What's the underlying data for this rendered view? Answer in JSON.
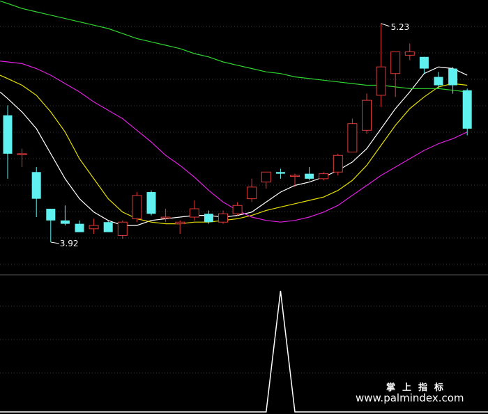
{
  "colors": {
    "background": "#000000",
    "grid": "#3a3a3a",
    "divider": "#555555",
    "candle_up": "#e03a3a",
    "candle_down": "#5ff0f0",
    "ma_short": "#ffffff",
    "ma_mid": "#e8e000",
    "ma_long": "#e020e0",
    "ma_longest": "#2fd42f",
    "indicator": "#ffffff"
  },
  "annotations": {
    "high_label": "5.23",
    "low_label": "3.92"
  },
  "watermark": {
    "cn": "掌上指标",
    "url": "www.palmindex.com"
  },
  "chart_data": [
    {
      "type": "candlestick",
      "title": "",
      "ylim": [
        3.82,
        5.35
      ],
      "grid": true,
      "candles": [
        {
          "o": 4.68,
          "h": 4.74,
          "l": 4.3,
          "c": 4.45
        },
        {
          "o": 4.45,
          "h": 4.48,
          "l": 4.37,
          "c": 4.45
        },
        {
          "o": 4.34,
          "h": 4.37,
          "l": 4.07,
          "c": 4.18
        },
        {
          "o": 4.12,
          "h": 4.12,
          "l": 3.92,
          "c": 4.05
        },
        {
          "o": 4.05,
          "h": 4.14,
          "l": 4.02,
          "c": 4.03
        },
        {
          "o": 4.03,
          "h": 4.05,
          "l": 3.98,
          "c": 3.98
        },
        {
          "o": 4.0,
          "h": 4.06,
          "l": 3.97,
          "c": 4.02
        },
        {
          "o": 4.04,
          "h": 4.05,
          "l": 3.98,
          "c": 3.98
        },
        {
          "o": 3.96,
          "h": 4.05,
          "l": 3.94,
          "c": 4.04
        },
        {
          "o": 4.06,
          "h": 4.22,
          "l": 4.04,
          "c": 4.2
        },
        {
          "o": 4.22,
          "h": 4.23,
          "l": 4.08,
          "c": 4.09
        },
        {
          "o": 4.07,
          "h": 4.12,
          "l": 4.04,
          "c": 4.07
        },
        {
          "o": 4.03,
          "h": 4.05,
          "l": 3.97,
          "c": 4.04
        },
        {
          "o": 4.07,
          "h": 4.17,
          "l": 4.05,
          "c": 4.12
        },
        {
          "o": 4.09,
          "h": 4.11,
          "l": 4.03,
          "c": 4.04
        },
        {
          "o": 4.04,
          "h": 4.11,
          "l": 4.03,
          "c": 4.09
        },
        {
          "o": 4.09,
          "h": 4.16,
          "l": 4.08,
          "c": 4.14
        },
        {
          "o": 4.18,
          "h": 4.3,
          "l": 4.16,
          "c": 4.25
        },
        {
          "o": 4.28,
          "h": 4.34,
          "l": 4.24,
          "c": 4.34
        },
        {
          "o": 4.34,
          "h": 4.36,
          "l": 4.3,
          "c": 4.33
        },
        {
          "o": 4.32,
          "h": 4.33,
          "l": 4.25,
          "c": 4.32
        },
        {
          "o": 4.33,
          "h": 4.37,
          "l": 4.29,
          "c": 4.3
        },
        {
          "o": 4.3,
          "h": 4.34,
          "l": 4.29,
          "c": 4.33
        },
        {
          "o": 4.34,
          "h": 4.45,
          "l": 4.32,
          "c": 4.44
        },
        {
          "o": 4.46,
          "h": 4.66,
          "l": 4.46,
          "c": 4.63
        },
        {
          "o": 4.59,
          "h": 4.81,
          "l": 4.57,
          "c": 4.77
        },
        {
          "o": 4.8,
          "h": 5.23,
          "l": 4.73,
          "c": 4.97
        },
        {
          "o": 4.93,
          "h": 5.06,
          "l": 4.79,
          "c": 5.06
        },
        {
          "o": 5.04,
          "h": 5.11,
          "l": 5.01,
          "c": 5.06
        },
        {
          "o": 5.03,
          "h": 5.03,
          "l": 4.93,
          "c": 4.96
        },
        {
          "o": 4.91,
          "h": 4.94,
          "l": 4.84,
          "c": 4.86
        },
        {
          "o": 4.96,
          "h": 4.97,
          "l": 4.81,
          "c": 4.86
        },
        {
          "o": 4.83,
          "h": 4.84,
          "l": 4.56,
          "c": 4.6
        }
      ],
      "moving_averages": [
        {
          "color_key": "ma_short",
          "values": [
            4.78,
            4.7,
            4.6,
            4.45,
            4.3,
            4.18,
            4.1,
            4.05,
            4.02,
            4.02,
            4.05,
            4.06,
            4.07,
            4.08,
            4.08,
            4.07,
            4.08,
            4.1,
            4.16,
            4.22,
            4.26,
            4.28,
            4.31,
            4.35,
            4.4,
            4.48,
            4.6,
            4.72,
            4.82,
            4.93,
            4.97,
            4.96,
            4.92
          ]
        },
        {
          "color_key": "ma_mid",
          "values": [
            4.9,
            4.86,
            4.8,
            4.7,
            4.58,
            4.42,
            4.3,
            4.18,
            4.1,
            4.06,
            4.04,
            4.03,
            4.03,
            4.04,
            4.04,
            4.05,
            4.06,
            4.08,
            4.11,
            4.13,
            4.15,
            4.17,
            4.19,
            4.23,
            4.29,
            4.38,
            4.5,
            4.62,
            4.72,
            4.79,
            4.85,
            4.87,
            4.86
          ]
        },
        {
          "color_key": "ma_long",
          "values": [
            5.0,
            4.99,
            4.96,
            4.92,
            4.87,
            4.82,
            4.76,
            4.71,
            4.66,
            4.59,
            4.52,
            4.44,
            4.38,
            4.31,
            4.23,
            4.16,
            4.11,
            4.07,
            4.05,
            4.04,
            4.05,
            4.07,
            4.1,
            4.14,
            4.2,
            4.26,
            4.32,
            4.37,
            4.42,
            4.47,
            4.51,
            4.54,
            4.58
          ]
        },
        {
          "color_key": "ma_longest",
          "values": [
            5.35,
            5.32,
            5.3,
            5.28,
            5.26,
            5.24,
            5.22,
            5.2,
            5.17,
            5.14,
            5.12,
            5.1,
            5.08,
            5.05,
            5.03,
            5.0,
            4.98,
            4.96,
            4.94,
            4.93,
            4.91,
            4.9,
            4.89,
            4.88,
            4.87,
            4.86,
            4.86,
            4.85,
            4.84,
            4.84,
            4.84,
            4.83,
            4.82
          ]
        }
      ],
      "high_index": 26,
      "low_index": 3
    },
    {
      "type": "line",
      "title": "",
      "ylim": [
        0,
        1
      ],
      "grid": true,
      "color_key": "indicator",
      "values": [
        0,
        0,
        0,
        0,
        0,
        0,
        0,
        0,
        0,
        0,
        0,
        0,
        0,
        0,
        0,
        0,
        0,
        0,
        0,
        1,
        0,
        0,
        0,
        0,
        0,
        0,
        0,
        0,
        0,
        0,
        0,
        0,
        0
      ]
    }
  ]
}
